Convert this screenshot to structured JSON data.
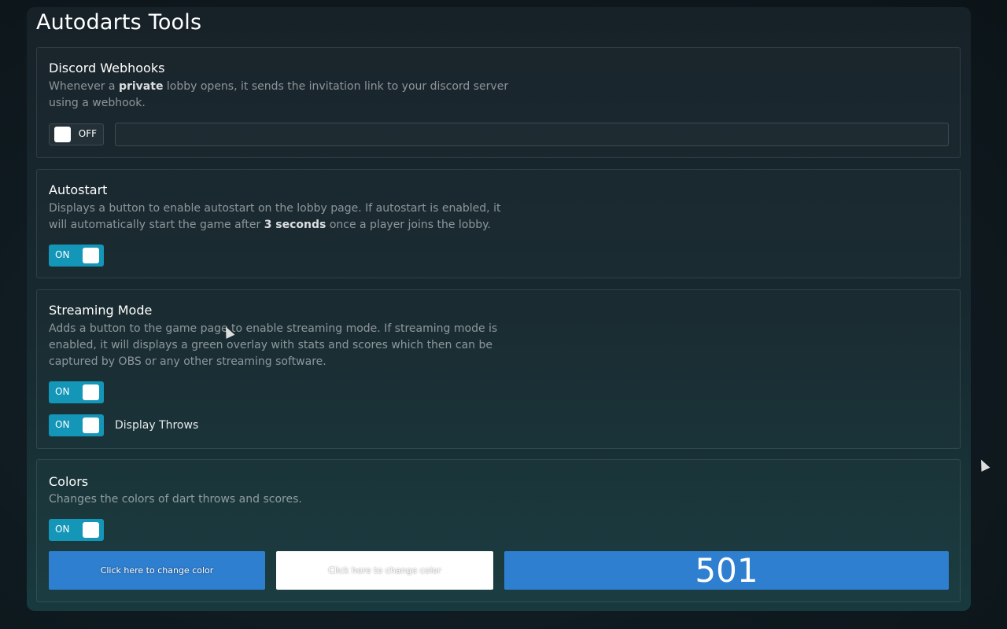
{
  "app": {
    "title": "Autodarts Tools"
  },
  "discord": {
    "title": "Discord Webhooks",
    "desc_pre": "Whenever a ",
    "desc_bold": "private",
    "desc_post": " lobby opens, it sends the invitation link to your discord server using a webhook.",
    "toggle_label": "OFF",
    "webhook_value": ""
  },
  "autostart": {
    "title": "Autostart",
    "desc_pre": "Displays a button to enable autostart on the lobby page. If autostart is enabled, it will automatically start the game after ",
    "desc_bold": "3 seconds",
    "desc_post": " once a player joins the lobby.",
    "toggle_label": "ON"
  },
  "streaming": {
    "title": "Streaming Mode",
    "desc": "Adds a button to the game page to enable streaming mode. If streaming mode is enabled, it will displays a green overlay with stats and scores which then can be captured by OBS or any other streaming software.",
    "toggle_label": "ON",
    "display_throws_toggle_label": "ON",
    "display_throws_label": "Display Throws"
  },
  "colors": {
    "title": "Colors",
    "desc": "Changes the colors of dart throws and scores.",
    "toggle_label": "ON",
    "color_button_1": "Click here to change color",
    "color_button_2": "Click here to change color",
    "score_preview": "501",
    "color_1": "#2f7fd0",
    "color_2": "#ffffff"
  },
  "accent_color": "#1496b8"
}
